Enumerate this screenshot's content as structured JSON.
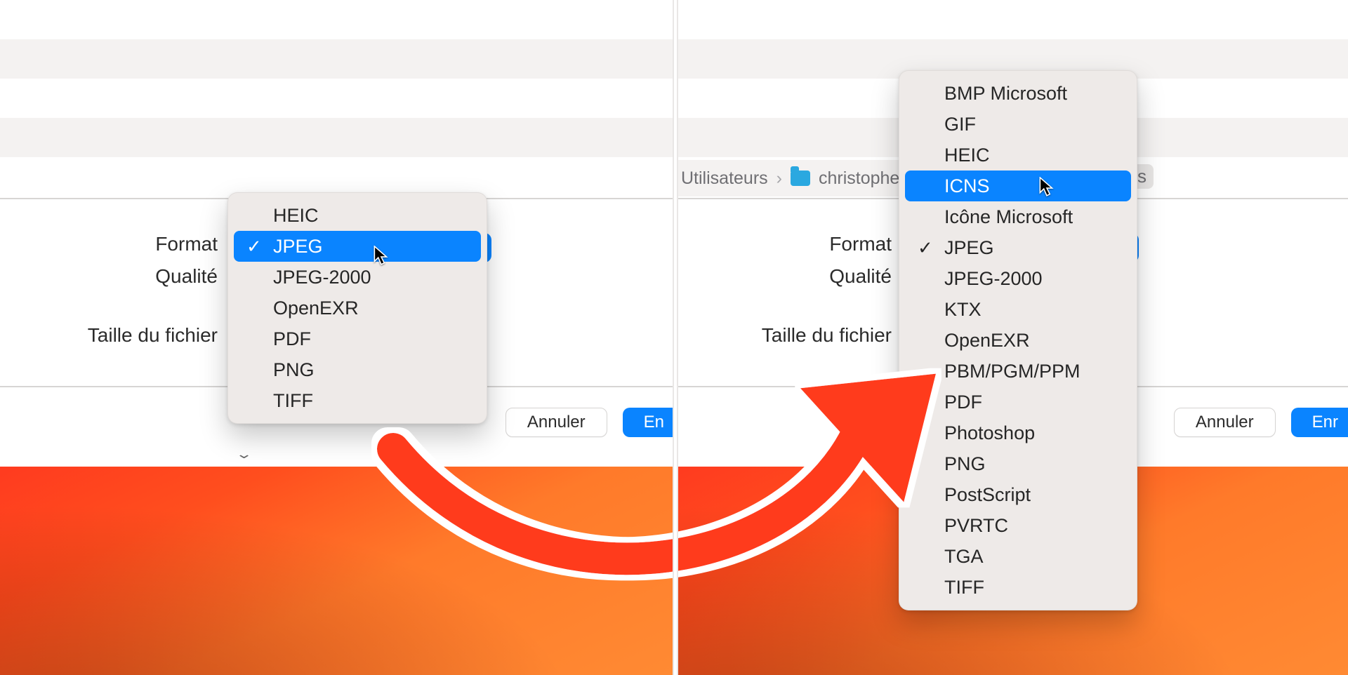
{
  "labels": {
    "format": "Format",
    "quality": "Qualité",
    "filesize": "Taille du fichier"
  },
  "buttons": {
    "cancel": "Annuler",
    "save_truncated_left": "En",
    "save_truncated_right": "Enr"
  },
  "breadcrumb": {
    "item1": "Utilisateurs",
    "item2": "christophe",
    "tail_letter": "s"
  },
  "left_menu": {
    "items": [
      {
        "label": "HEIC",
        "checked": false,
        "selected": false
      },
      {
        "label": "JPEG",
        "checked": true,
        "selected": true
      },
      {
        "label": "JPEG-2000",
        "checked": false,
        "selected": false
      },
      {
        "label": "OpenEXR",
        "checked": false,
        "selected": false
      },
      {
        "label": "PDF",
        "checked": false,
        "selected": false
      },
      {
        "label": "PNG",
        "checked": false,
        "selected": false
      },
      {
        "label": "TIFF",
        "checked": false,
        "selected": false
      }
    ]
  },
  "right_menu": {
    "items": [
      {
        "label": "BMP Microsoft",
        "checked": false,
        "selected": false
      },
      {
        "label": "GIF",
        "checked": false,
        "selected": false
      },
      {
        "label": "HEIC",
        "checked": false,
        "selected": false
      },
      {
        "label": "ICNS",
        "checked": false,
        "selected": true
      },
      {
        "label": "Icône Microsoft",
        "checked": false,
        "selected": false
      },
      {
        "label": "JPEG",
        "checked": true,
        "selected": false
      },
      {
        "label": "JPEG-2000",
        "checked": false,
        "selected": false
      },
      {
        "label": "KTX",
        "checked": false,
        "selected": false
      },
      {
        "label": "OpenEXR",
        "checked": false,
        "selected": false
      },
      {
        "label": "PBM/PGM/PPM",
        "checked": false,
        "selected": false
      },
      {
        "label": "PDF",
        "checked": false,
        "selected": false
      },
      {
        "label": "Photoshop",
        "checked": false,
        "selected": false
      },
      {
        "label": "PNG",
        "checked": false,
        "selected": false
      },
      {
        "label": "PostScript",
        "checked": false,
        "selected": false
      },
      {
        "label": "PVRTC",
        "checked": false,
        "selected": false
      },
      {
        "label": "TGA",
        "checked": false,
        "selected": false
      },
      {
        "label": "TIFF",
        "checked": false,
        "selected": false
      }
    ]
  },
  "colors": {
    "accent": "#0a84ff",
    "arrow": "#ff3b1f"
  }
}
